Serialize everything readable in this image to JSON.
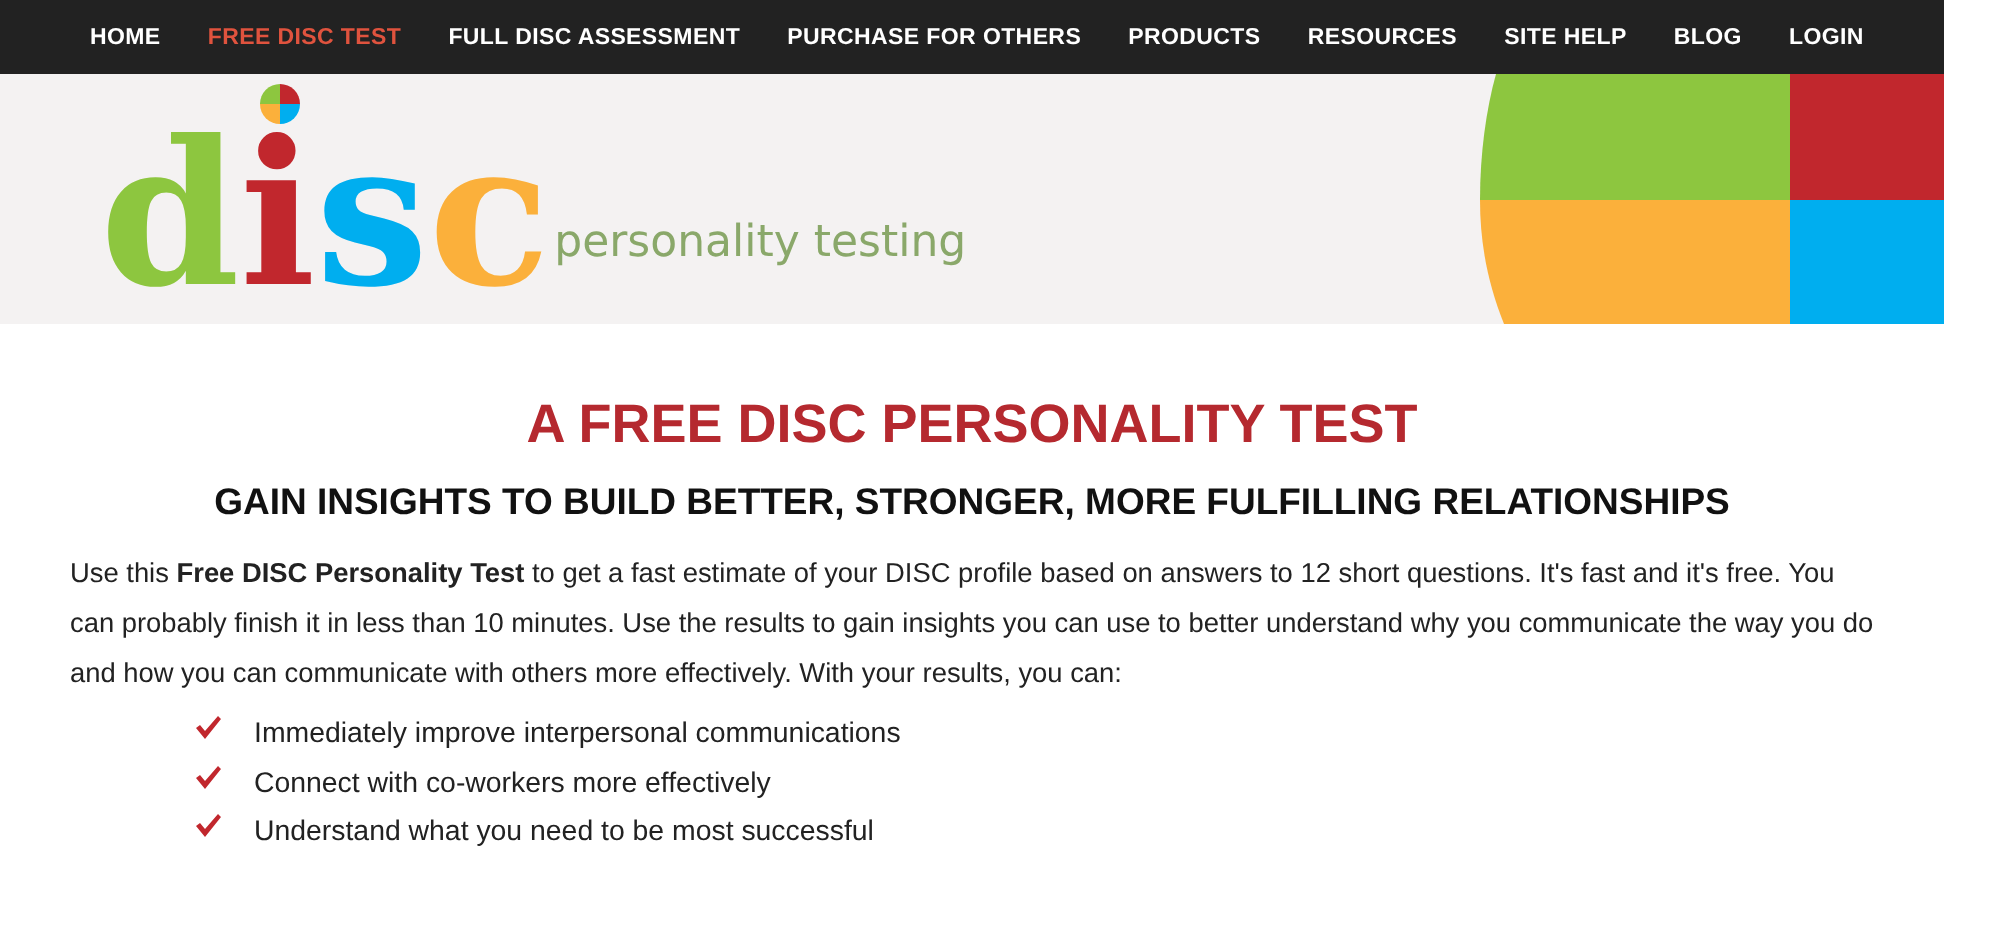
{
  "nav": [
    {
      "label": "HOME",
      "selected": false
    },
    {
      "label": "FREE DISC TEST",
      "selected": true
    },
    {
      "label": "FULL DISC ASSESSMENT",
      "selected": false
    },
    {
      "label": "PURCHASE FOR OTHERS",
      "selected": false
    },
    {
      "label": "PRODUCTS",
      "selected": false
    },
    {
      "label": "RESOURCES",
      "selected": false
    },
    {
      "label": "SITE HELP",
      "selected": false
    },
    {
      "label": "BLOG",
      "selected": false
    },
    {
      "label": "LOGIN",
      "selected": false
    }
  ],
  "logo": {
    "letters": [
      {
        "text": "d",
        "color": "#8dc63f"
      },
      {
        "text": "i",
        "color": "#c1272d"
      },
      {
        "text": "s",
        "color": "#00aeef"
      },
      {
        "text": "c",
        "color": "#fbb03b"
      }
    ],
    "tagline": "personality testing"
  },
  "title": "A FREE DISC PERSONALITY TEST",
  "subtitle": "GAIN INSIGHTS TO BUILD BETTER, STRONGER, MORE FULFILLING RELATIONSHIPS",
  "intro": "Use this **Free DISC Personality Test** to get a fast estimate of your DISC profile based on answers to 12 short questions. It's fast and it's free. You can probably finish it in less than 10 minutes. Use the results to gain insights you can use to better understand why you communicate the way you do and how you can communicate with others more effectively. With your results, you can:",
  "benefits": [
    "Immediately improve interpersonal communications",
    "Connect with co-workers more effectively",
    "Understand what you need to be most successful"
  ]
}
